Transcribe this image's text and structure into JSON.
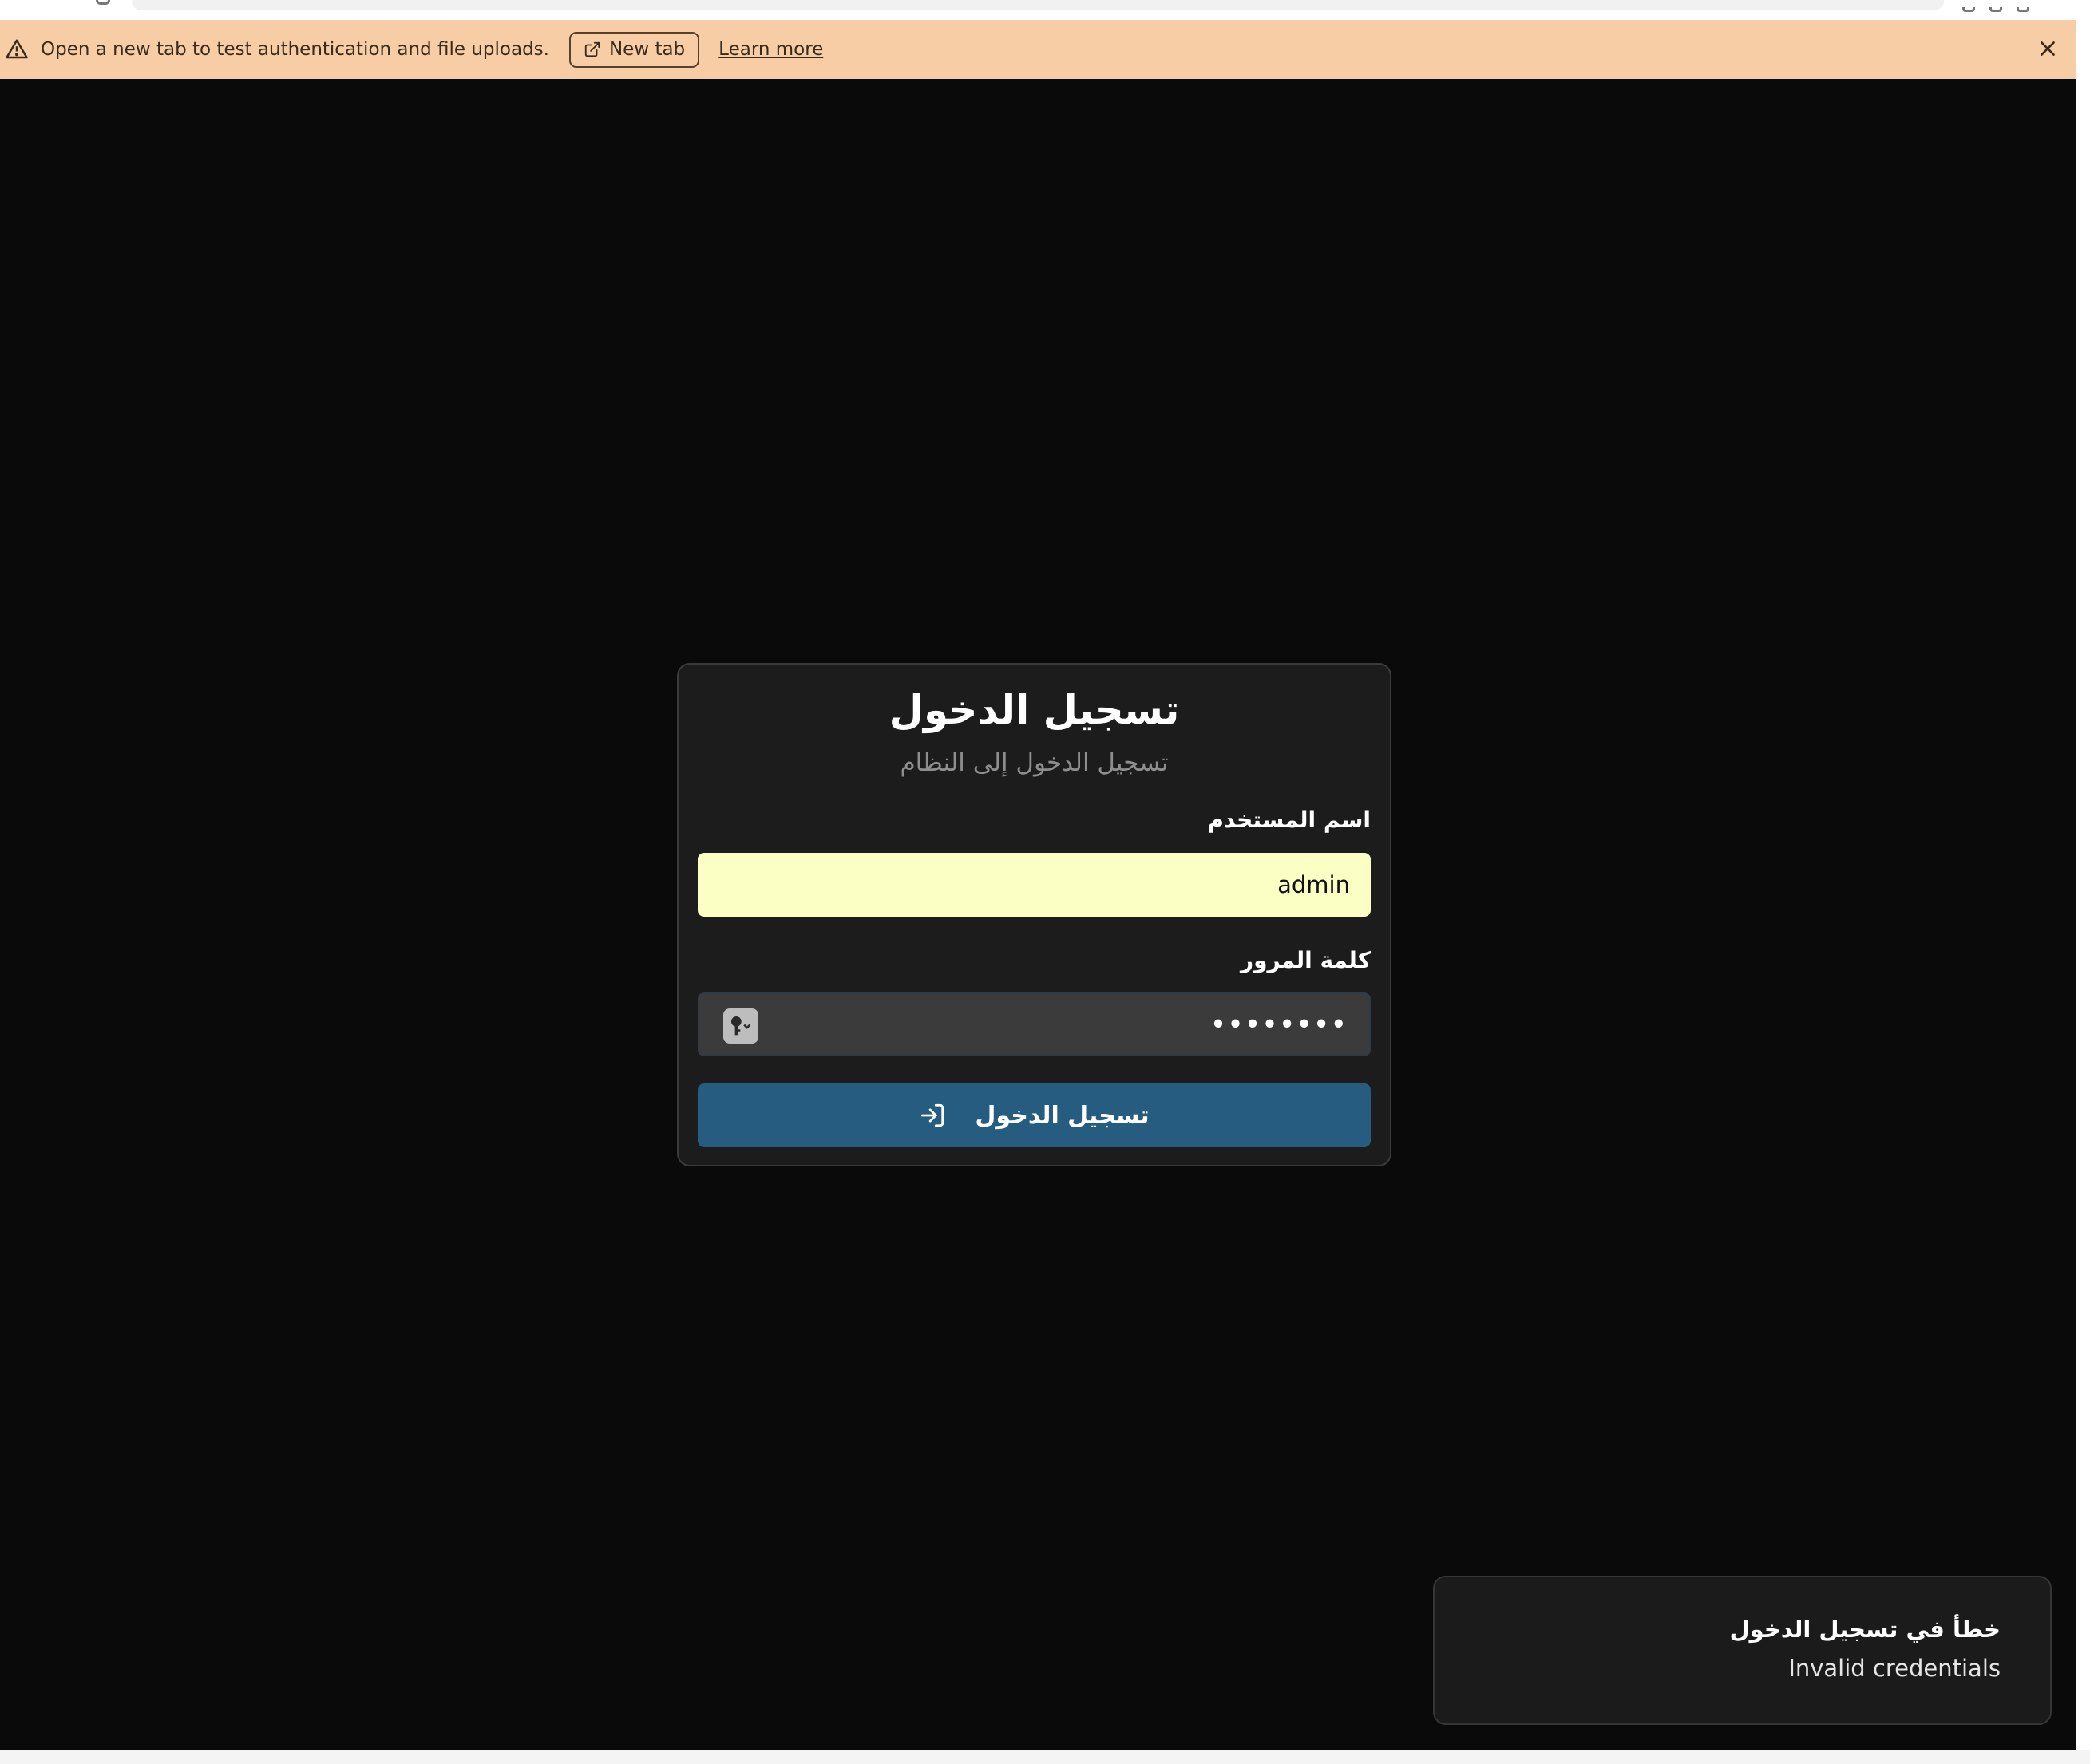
{
  "banner": {
    "message": "Open a new tab to test authentication and file uploads.",
    "new_tab_label": "New tab",
    "learn_more_label": "Learn more",
    "icons": {
      "warning": "warning-triangle-icon",
      "external": "external-link-icon",
      "close": "close-icon"
    }
  },
  "login": {
    "title": "تسجيل الدخول",
    "subtitle": "تسجيل الدخول إلى النظام",
    "username_label": "اسم المستخدم",
    "username_value": "admin",
    "password_label": "كلمة المرور",
    "password_value": "••••••••",
    "submit_label": "تسجيل الدخول",
    "icons": {
      "password_manager": "key-icon",
      "submit": "login-arrow-icon"
    }
  },
  "toast": {
    "title": "خطأ في تسجيل الدخول",
    "description": "Invalid credentials"
  },
  "colors": {
    "banner_bg": "#f6cda4",
    "app_bg": "#0a0a0a",
    "card_bg": "#1c1c1c",
    "primary_button": "#265c80",
    "autofill_bg": "#fbffc4"
  }
}
